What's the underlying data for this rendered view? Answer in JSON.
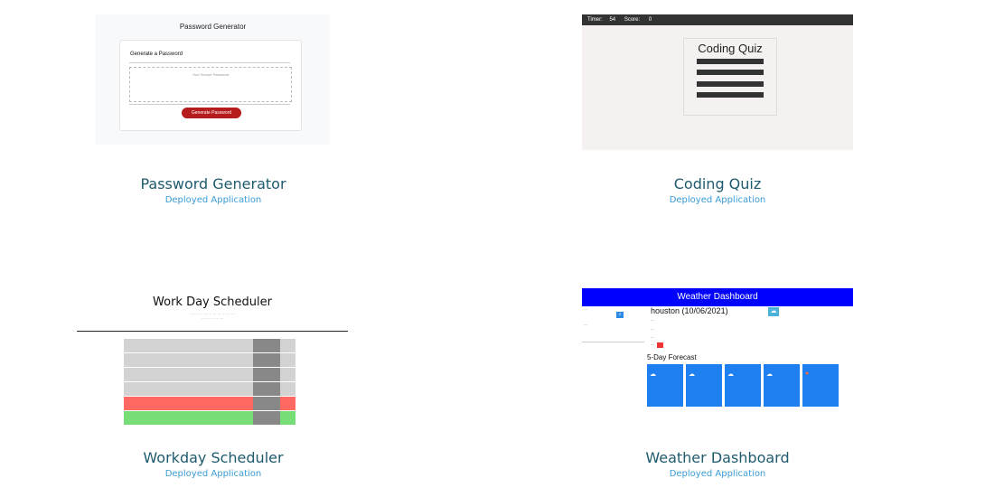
{
  "projects": [
    {
      "name": "Password Generator",
      "link": "Deployed Application",
      "preview": {
        "header": "Password Generator",
        "card_title": "Generate a Password",
        "placeholder": "Your Secure Password",
        "button": "Generate Password",
        "button_color": "#b71c1c"
      }
    },
    {
      "name": "Coding Quiz",
      "link": "Deployed Application",
      "preview": {
        "timer_label": "Timer:",
        "timer_value": "54",
        "score_label": "Score:",
        "score_value": "0",
        "title": "Coding Quiz"
      }
    },
    {
      "name": "Workday Scheduler",
      "link": "Deployed Application",
      "preview": {
        "title": "Work Day Scheduler",
        "rows": [
          {
            "state": "past",
            "color": "#d3d3d3"
          },
          {
            "state": "past",
            "color": "#d3d3d3"
          },
          {
            "state": "past",
            "color": "#d3d3d3"
          },
          {
            "state": "past",
            "color": "#d3d3d3"
          },
          {
            "state": "present",
            "color": "#ff6961"
          },
          {
            "state": "future",
            "color": "#77dd77"
          }
        ]
      }
    },
    {
      "name": "Weather Dashboard",
      "link": "Deployed Application",
      "preview": {
        "header": "Weather Dashboard",
        "header_color": "#0000ff",
        "city": "houston (10/06/2021)",
        "forecast_title": "5-Day Forecast",
        "card_color": "#1e7ff0",
        "cards": [
          {
            "icon": "cloud-icon"
          },
          {
            "icon": "cloud-icon"
          },
          {
            "icon": "cloud-icon"
          },
          {
            "icon": "cloud-icon"
          },
          {
            "icon": "sun-icon"
          }
        ]
      }
    }
  ]
}
